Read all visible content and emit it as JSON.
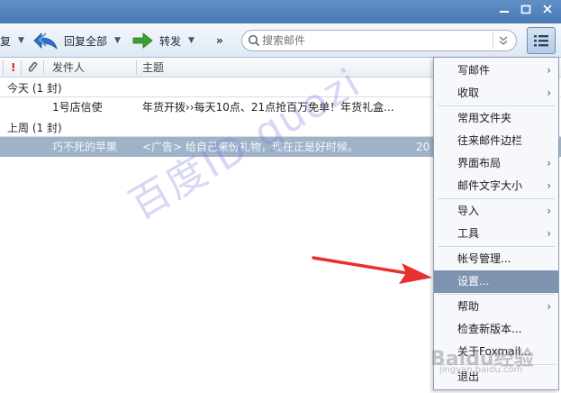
{
  "toolbar": {
    "partial_left": "复",
    "reply_all": "回复全部",
    "forward": "转发",
    "more": "»"
  },
  "search": {
    "placeholder": "搜索邮件"
  },
  "columns": {
    "flag": "!",
    "sender": "发件人",
    "subject": "主题"
  },
  "mail_groups": [
    {
      "label": "今天 (1 封)",
      "rows": [
        {
          "sender": "1号店信使",
          "subject": "年货开拨››每天10点、21点抢百万免单！年货礼盒..."
        }
      ]
    },
    {
      "label": "上周 (1 封)",
      "rows": [
        {
          "sender": "巧不死的苹果",
          "subject": "<广告> 给自己来份礼物，现在正是好时候。",
          "date_partial": "20"
        }
      ]
    }
  ],
  "menu": {
    "items": [
      {
        "label": "写邮件",
        "submenu": true
      },
      {
        "label": "收取",
        "submenu": true
      },
      {
        "label": "常用文件夹",
        "submenu": false
      },
      {
        "label": "往来邮件边栏",
        "submenu": false
      },
      {
        "label": "界面布局",
        "submenu": true
      },
      {
        "label": "邮件文字大小",
        "submenu": true
      },
      {
        "label": "导入",
        "submenu": true
      },
      {
        "label": "工具",
        "submenu": true
      },
      {
        "label": "帐号管理...",
        "submenu": false
      },
      {
        "label": "设置...",
        "submenu": false,
        "hover": true
      },
      {
        "label": "帮助",
        "submenu": true
      },
      {
        "label": "检查新版本...",
        "submenu": false
      },
      {
        "label": "关于Foxmail...",
        "submenu": false
      },
      {
        "label": "退出",
        "submenu": false
      }
    ]
  },
  "watermark": {
    "diagonal": "百度ID guozi",
    "logo": "Baidu经验",
    "url": "jingyan.baidu.com"
  },
  "colors": {
    "titlebar": "#4a7ab4",
    "selected_row": "#9fb3c8",
    "menu_hover": "#7e94ae",
    "arrow": "#e8302e",
    "forward_icon": "#3aa12f",
    "reply_icon": "#2f6fc4",
    "flag": "#d41f1f"
  }
}
